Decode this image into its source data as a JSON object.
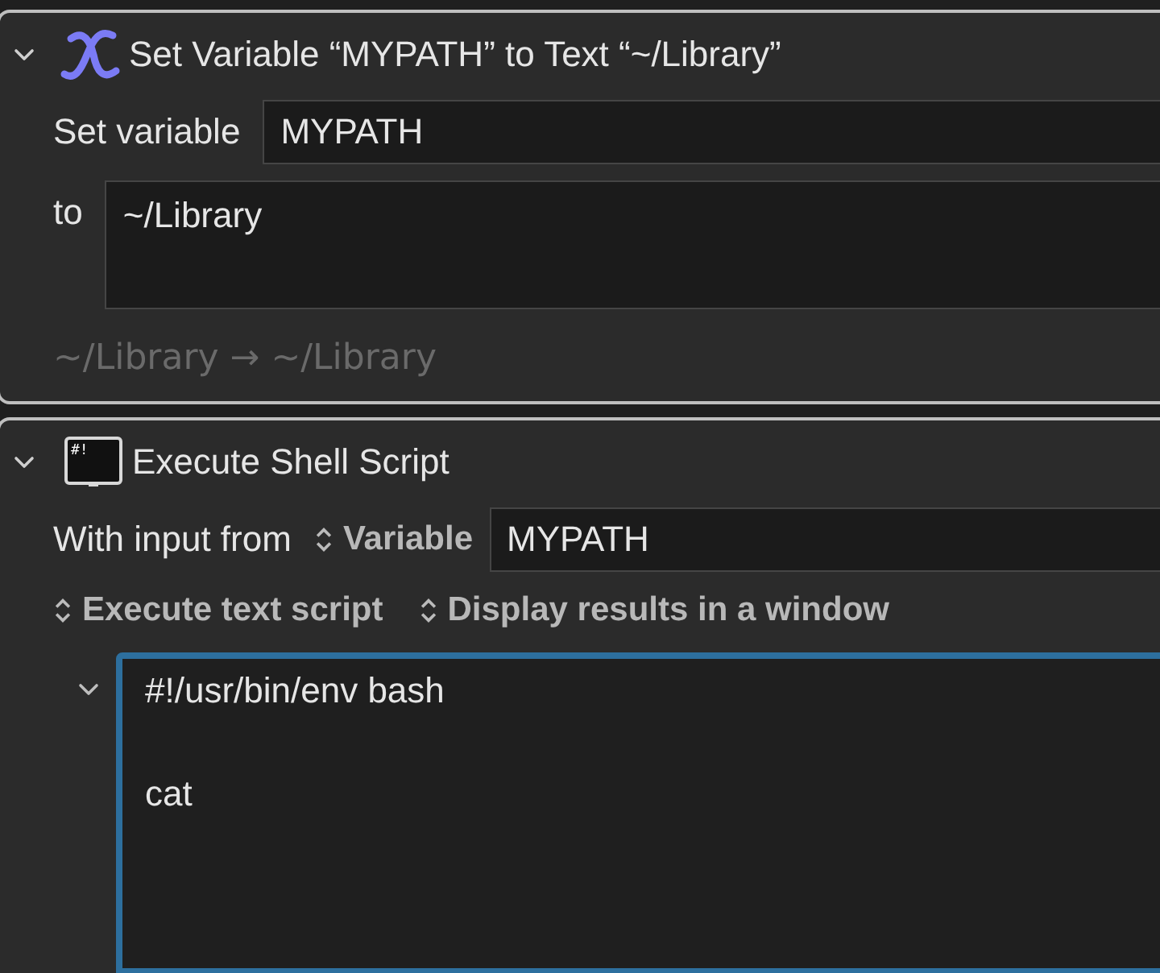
{
  "actions": [
    {
      "kind": "set_variable",
      "expanded": true,
      "title": "Set Variable “MYPATH” to Text “~/Library”",
      "variable_label": "Set variable",
      "variable_value": "MYPATH",
      "to_label": "to",
      "text_value": "~/Library",
      "preview": "~/Library → ~/Library"
    },
    {
      "kind": "shell_script",
      "expanded": true,
      "title": "Execute Shell Script",
      "icon_text": "#!",
      "input_label": "With input from",
      "input_source": "Variable",
      "input_variable": "MYPATH",
      "script_source": "Execute text script",
      "output_mode": "Display results in a window",
      "script_expanded": true,
      "script_focused": true,
      "script": "#!/usr/bin/env bash\n\ncat"
    }
  ]
}
